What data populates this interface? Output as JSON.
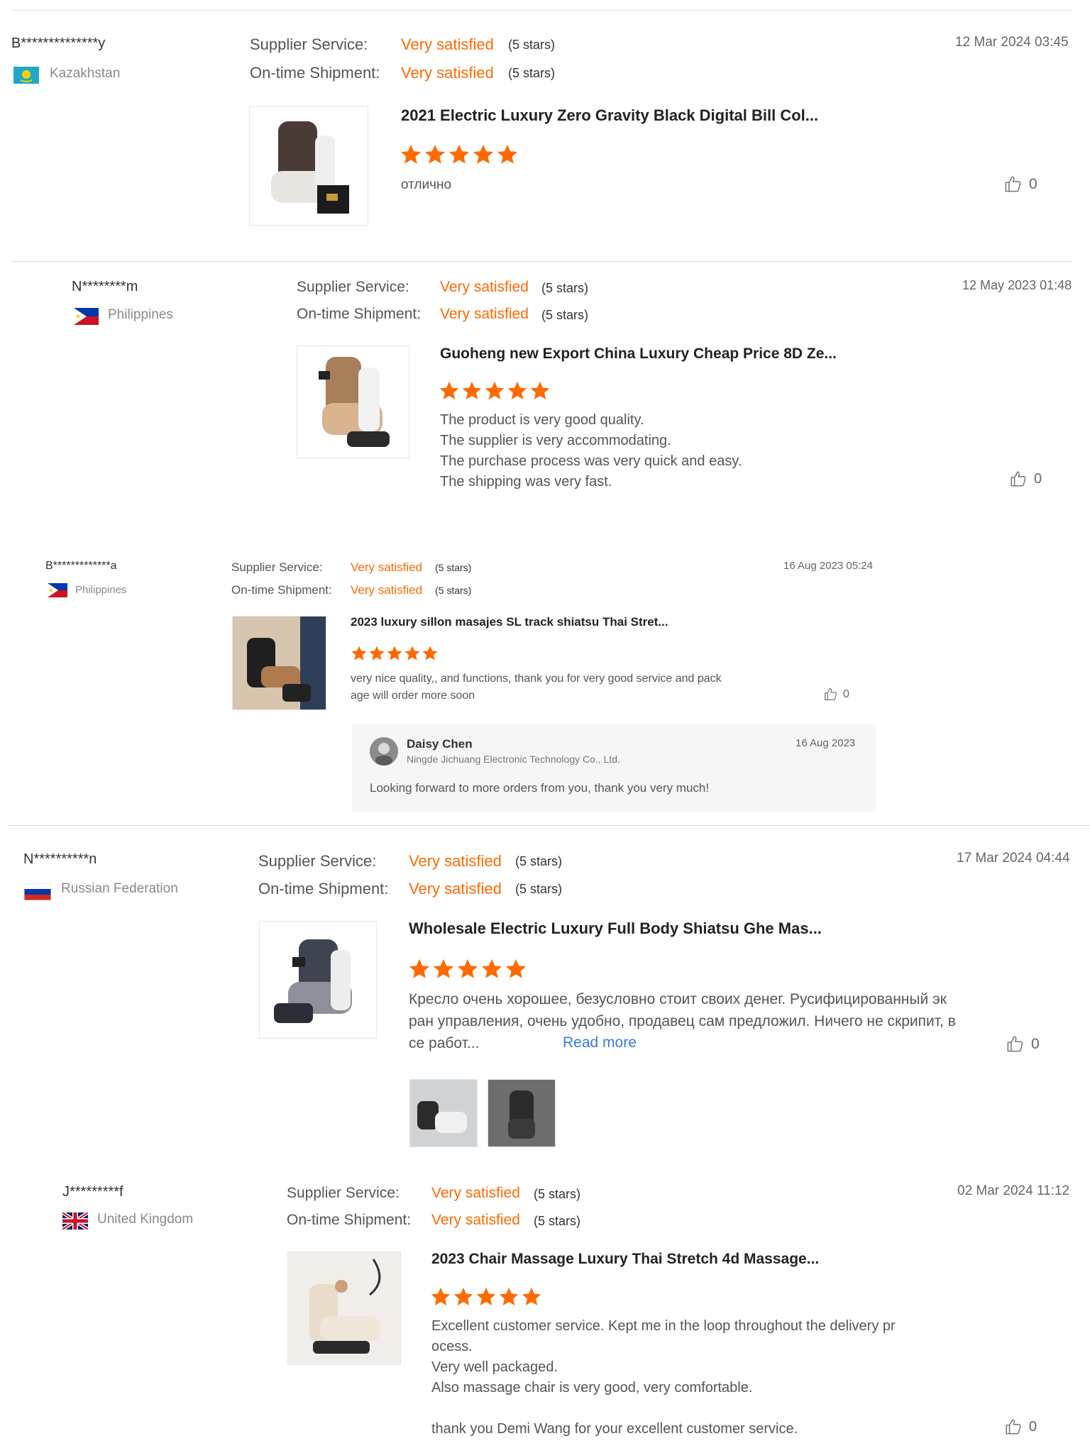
{
  "reviews": [
    {
      "buyer": "B**************y",
      "country": "Kazakhstan",
      "supplier_label": "Supplier Service:",
      "supplier_rating": "Very satisfied",
      "supplier_stars": "(5 stars)",
      "shipment_label": "On-time Shipment:",
      "shipment_rating": "Very satisfied",
      "shipment_stars": "(5 stars)",
      "date": "12 Mar 2024 03:45",
      "product_title": "2021 Electric Luxury Zero Gravity Black Digital Bill Col...",
      "star_rating": 5,
      "text_lines": [
        "отлично"
      ],
      "likes": "0"
    },
    {
      "buyer": "N********m",
      "country": "Philippines",
      "supplier_label": "Supplier Service:",
      "supplier_rating": "Very satisfied",
      "supplier_stars": "(5 stars)",
      "shipment_label": "On-time Shipment:",
      "shipment_rating": "Very satisfied",
      "shipment_stars": "(5 stars)",
      "date": "12 May 2023 01:48",
      "product_title": "Guoheng new Export China Luxury Cheap Price 8D Ze...",
      "star_rating": 5,
      "text_lines": [
        "The product is very good quality.",
        "The supplier is very accommodating.",
        "The purchase process was very quick and easy.",
        "The shipping was very fast."
      ],
      "likes": "0"
    },
    {
      "buyer": "B*************a",
      "country": "Philippines",
      "supplier_label": "Supplier Service:",
      "supplier_rating": "Very satisfied",
      "supplier_stars": "(5 stars)",
      "shipment_label": "On-time Shipment:",
      "shipment_rating": "Very satisfied",
      "shipment_stars": "(5 stars)",
      "date": "16 Aug 2023 05:24",
      "product_title": "2023 luxury sillon masajes SL track shiatsu Thai Stret...",
      "star_rating": 5,
      "text_lines": [
        "very nice quality,, and functions, thank you for very good service and pack",
        "age will order more soon"
      ],
      "likes": "0",
      "reply": {
        "name": "Daisy Chen",
        "company": "Ningde Jichuang Electronic Technology Co., Ltd.",
        "date": "16 Aug 2023",
        "text": "Looking forward to more orders from you, thank you very much!"
      }
    },
    {
      "buyer": "N**********n",
      "country": "Russian Federation",
      "supplier_label": "Supplier Service:",
      "supplier_rating": "Very satisfied",
      "supplier_stars": "(5 stars)",
      "shipment_label": "On-time Shipment:",
      "shipment_rating": "Very satisfied",
      "shipment_stars": "(5 stars)",
      "date": "17 Mar 2024 04:44",
      "product_title": "Wholesale Electric Luxury Full Body Shiatsu Ghe Mas...",
      "star_rating": 5,
      "text_lines": [
        "Кресло очень хорошее, безусловно стоит своих денег. Русифицированный эк",
        "ран управления, очень удобно, продавец сам предложил. Ничего не скрипит, в",
        "се работ..."
      ],
      "read_more": "Read more",
      "likes": "0"
    },
    {
      "buyer": "J*********f",
      "country": "United Kingdom",
      "supplier_label": "Supplier Service:",
      "supplier_rating": "Very satisfied",
      "supplier_stars": "(5 stars)",
      "shipment_label": "On-time Shipment:",
      "shipment_rating": "Very satisfied",
      "shipment_stars": "(5 stars)",
      "date": "02 Mar 2024 11:12",
      "product_title": "2023 Chair Massage Luxury Thai Stretch 4d Massage...",
      "star_rating": 5,
      "text_lines": [
        "Excellent customer service. Kept me in the loop throughout the delivery pr",
        "ocess.",
        "Very well packaged.",
        "Also massage chair is very good, very comfortable.",
        "",
        "thank you Demi Wang for your excellent customer service."
      ],
      "likes": "0"
    }
  ],
  "colors": {
    "accent": "#ff6a00",
    "link": "#3a7bd5",
    "divider": "#dcdcdc"
  },
  "icons": [
    "star-icon",
    "thumbs-up-icon",
    "flag-icon",
    "avatar"
  ]
}
